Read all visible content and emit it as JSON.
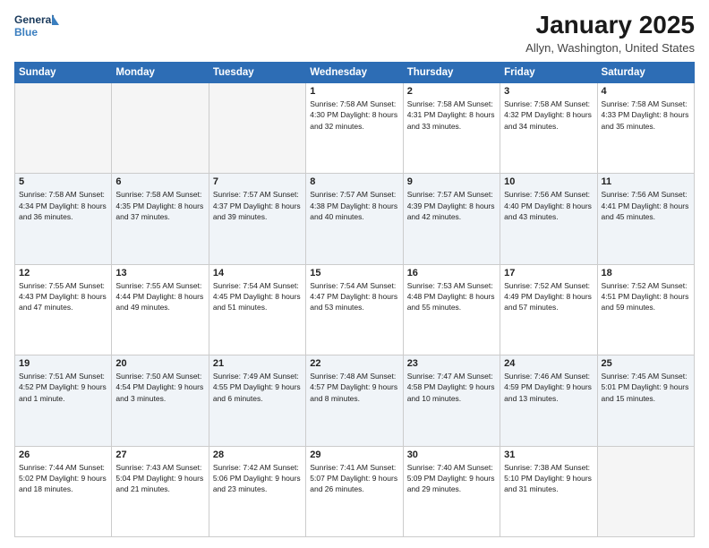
{
  "logo": {
    "line1": "General",
    "line2": "Blue"
  },
  "title": "January 2025",
  "location": "Allyn, Washington, United States",
  "headers": [
    "Sunday",
    "Monday",
    "Tuesday",
    "Wednesday",
    "Thursday",
    "Friday",
    "Saturday"
  ],
  "weeks": [
    [
      {
        "day": "",
        "info": ""
      },
      {
        "day": "",
        "info": ""
      },
      {
        "day": "",
        "info": ""
      },
      {
        "day": "1",
        "info": "Sunrise: 7:58 AM\nSunset: 4:30 PM\nDaylight: 8 hours and 32 minutes."
      },
      {
        "day": "2",
        "info": "Sunrise: 7:58 AM\nSunset: 4:31 PM\nDaylight: 8 hours and 33 minutes."
      },
      {
        "day": "3",
        "info": "Sunrise: 7:58 AM\nSunset: 4:32 PM\nDaylight: 8 hours and 34 minutes."
      },
      {
        "day": "4",
        "info": "Sunrise: 7:58 AM\nSunset: 4:33 PM\nDaylight: 8 hours and 35 minutes."
      }
    ],
    [
      {
        "day": "5",
        "info": "Sunrise: 7:58 AM\nSunset: 4:34 PM\nDaylight: 8 hours and 36 minutes."
      },
      {
        "day": "6",
        "info": "Sunrise: 7:58 AM\nSunset: 4:35 PM\nDaylight: 8 hours and 37 minutes."
      },
      {
        "day": "7",
        "info": "Sunrise: 7:57 AM\nSunset: 4:37 PM\nDaylight: 8 hours and 39 minutes."
      },
      {
        "day": "8",
        "info": "Sunrise: 7:57 AM\nSunset: 4:38 PM\nDaylight: 8 hours and 40 minutes."
      },
      {
        "day": "9",
        "info": "Sunrise: 7:57 AM\nSunset: 4:39 PM\nDaylight: 8 hours and 42 minutes."
      },
      {
        "day": "10",
        "info": "Sunrise: 7:56 AM\nSunset: 4:40 PM\nDaylight: 8 hours and 43 minutes."
      },
      {
        "day": "11",
        "info": "Sunrise: 7:56 AM\nSunset: 4:41 PM\nDaylight: 8 hours and 45 minutes."
      }
    ],
    [
      {
        "day": "12",
        "info": "Sunrise: 7:55 AM\nSunset: 4:43 PM\nDaylight: 8 hours and 47 minutes."
      },
      {
        "day": "13",
        "info": "Sunrise: 7:55 AM\nSunset: 4:44 PM\nDaylight: 8 hours and 49 minutes."
      },
      {
        "day": "14",
        "info": "Sunrise: 7:54 AM\nSunset: 4:45 PM\nDaylight: 8 hours and 51 minutes."
      },
      {
        "day": "15",
        "info": "Sunrise: 7:54 AM\nSunset: 4:47 PM\nDaylight: 8 hours and 53 minutes."
      },
      {
        "day": "16",
        "info": "Sunrise: 7:53 AM\nSunset: 4:48 PM\nDaylight: 8 hours and 55 minutes."
      },
      {
        "day": "17",
        "info": "Sunrise: 7:52 AM\nSunset: 4:49 PM\nDaylight: 8 hours and 57 minutes."
      },
      {
        "day": "18",
        "info": "Sunrise: 7:52 AM\nSunset: 4:51 PM\nDaylight: 8 hours and 59 minutes."
      }
    ],
    [
      {
        "day": "19",
        "info": "Sunrise: 7:51 AM\nSunset: 4:52 PM\nDaylight: 9 hours and 1 minute."
      },
      {
        "day": "20",
        "info": "Sunrise: 7:50 AM\nSunset: 4:54 PM\nDaylight: 9 hours and 3 minutes."
      },
      {
        "day": "21",
        "info": "Sunrise: 7:49 AM\nSunset: 4:55 PM\nDaylight: 9 hours and 6 minutes."
      },
      {
        "day": "22",
        "info": "Sunrise: 7:48 AM\nSunset: 4:57 PM\nDaylight: 9 hours and 8 minutes."
      },
      {
        "day": "23",
        "info": "Sunrise: 7:47 AM\nSunset: 4:58 PM\nDaylight: 9 hours and 10 minutes."
      },
      {
        "day": "24",
        "info": "Sunrise: 7:46 AM\nSunset: 4:59 PM\nDaylight: 9 hours and 13 minutes."
      },
      {
        "day": "25",
        "info": "Sunrise: 7:45 AM\nSunset: 5:01 PM\nDaylight: 9 hours and 15 minutes."
      }
    ],
    [
      {
        "day": "26",
        "info": "Sunrise: 7:44 AM\nSunset: 5:02 PM\nDaylight: 9 hours and 18 minutes."
      },
      {
        "day": "27",
        "info": "Sunrise: 7:43 AM\nSunset: 5:04 PM\nDaylight: 9 hours and 21 minutes."
      },
      {
        "day": "28",
        "info": "Sunrise: 7:42 AM\nSunset: 5:06 PM\nDaylight: 9 hours and 23 minutes."
      },
      {
        "day": "29",
        "info": "Sunrise: 7:41 AM\nSunset: 5:07 PM\nDaylight: 9 hours and 26 minutes."
      },
      {
        "day": "30",
        "info": "Sunrise: 7:40 AM\nSunset: 5:09 PM\nDaylight: 9 hours and 29 minutes."
      },
      {
        "day": "31",
        "info": "Sunrise: 7:38 AM\nSunset: 5:10 PM\nDaylight: 9 hours and 31 minutes."
      },
      {
        "day": "",
        "info": ""
      }
    ]
  ]
}
